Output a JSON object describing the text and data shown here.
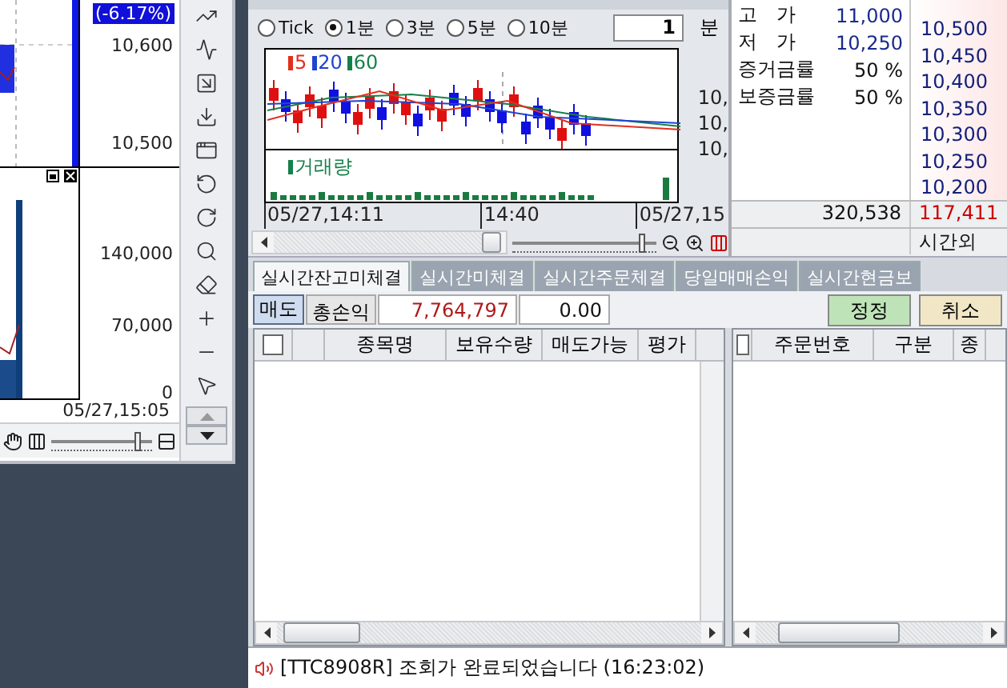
{
  "left_chart": {
    "change_badge": "(-6.17%)",
    "price_axis": [
      "10,600",
      "10,500"
    ],
    "volume_axis": [
      "140,000",
      "70,000",
      "0"
    ],
    "time_label": "05/27,15:05",
    "slider": {
      "level": 0.85
    }
  },
  "minute_chart": {
    "intervals": [
      {
        "label": "Tick",
        "selected": false
      },
      {
        "label": "1분",
        "selected": true
      },
      {
        "label": "3분",
        "selected": false
      },
      {
        "label": "5분",
        "selected": false
      },
      {
        "label": "10분",
        "selected": false
      }
    ],
    "period": "1",
    "period_unit": "분",
    "legend": [
      {
        "label": "5",
        "color": "#e0301e"
      },
      {
        "label": "20",
        "color": "#1f44d0"
      },
      {
        "label": "60",
        "color": "#16804a"
      }
    ],
    "price_axis": [
      "10,",
      "10,",
      "10,"
    ],
    "volume_legend": "거래량",
    "time_labels": [
      "05/27,14:11",
      "14:40",
      "05/27,15"
    ],
    "zoom_slider": {
      "level": 0.9
    }
  },
  "quote": {
    "rows": [
      {
        "label": "고 가",
        "value": "11,000"
      },
      {
        "label": "저 가",
        "value": "10,250"
      },
      {
        "label": "증거금률",
        "value": "50 %"
      },
      {
        "label": "보증금률",
        "value": "50 %"
      }
    ],
    "ladder": [
      "10,500",
      "10,450",
      "10,400",
      "10,350",
      "10,300",
      "10,250",
      "10,200"
    ],
    "total": "320,538",
    "total_other": "117,411",
    "session": "시간외"
  },
  "tabs": [
    {
      "label": "실시간잔고미체결",
      "selected": true
    },
    {
      "label": "실시간미체결",
      "selected": false
    },
    {
      "label": "실시간주문체결",
      "selected": false
    },
    {
      "label": "당일매매손익",
      "selected": false
    },
    {
      "label": "실시간현금보",
      "selected": false
    }
  ],
  "order_bar": {
    "sell_button": "매도",
    "pnl_label": "총손익",
    "pnl": "7,764,797",
    "rate": "0.00",
    "buttons": [
      {
        "label": "정정",
        "kind": "modify"
      },
      {
        "label": "취소",
        "kind": "cancel"
      }
    ]
  },
  "holdings_table": {
    "select_all_checked": false,
    "columns": [
      "종목명",
      "보유수량",
      "매도가능",
      "평가"
    ]
  },
  "orders_table": {
    "select_all_checked": false,
    "columns": [
      "주문번호",
      "구분",
      "종"
    ]
  },
  "status": "[TTC8908R] 조회가 완료되었습니다 (16:23:02)"
}
